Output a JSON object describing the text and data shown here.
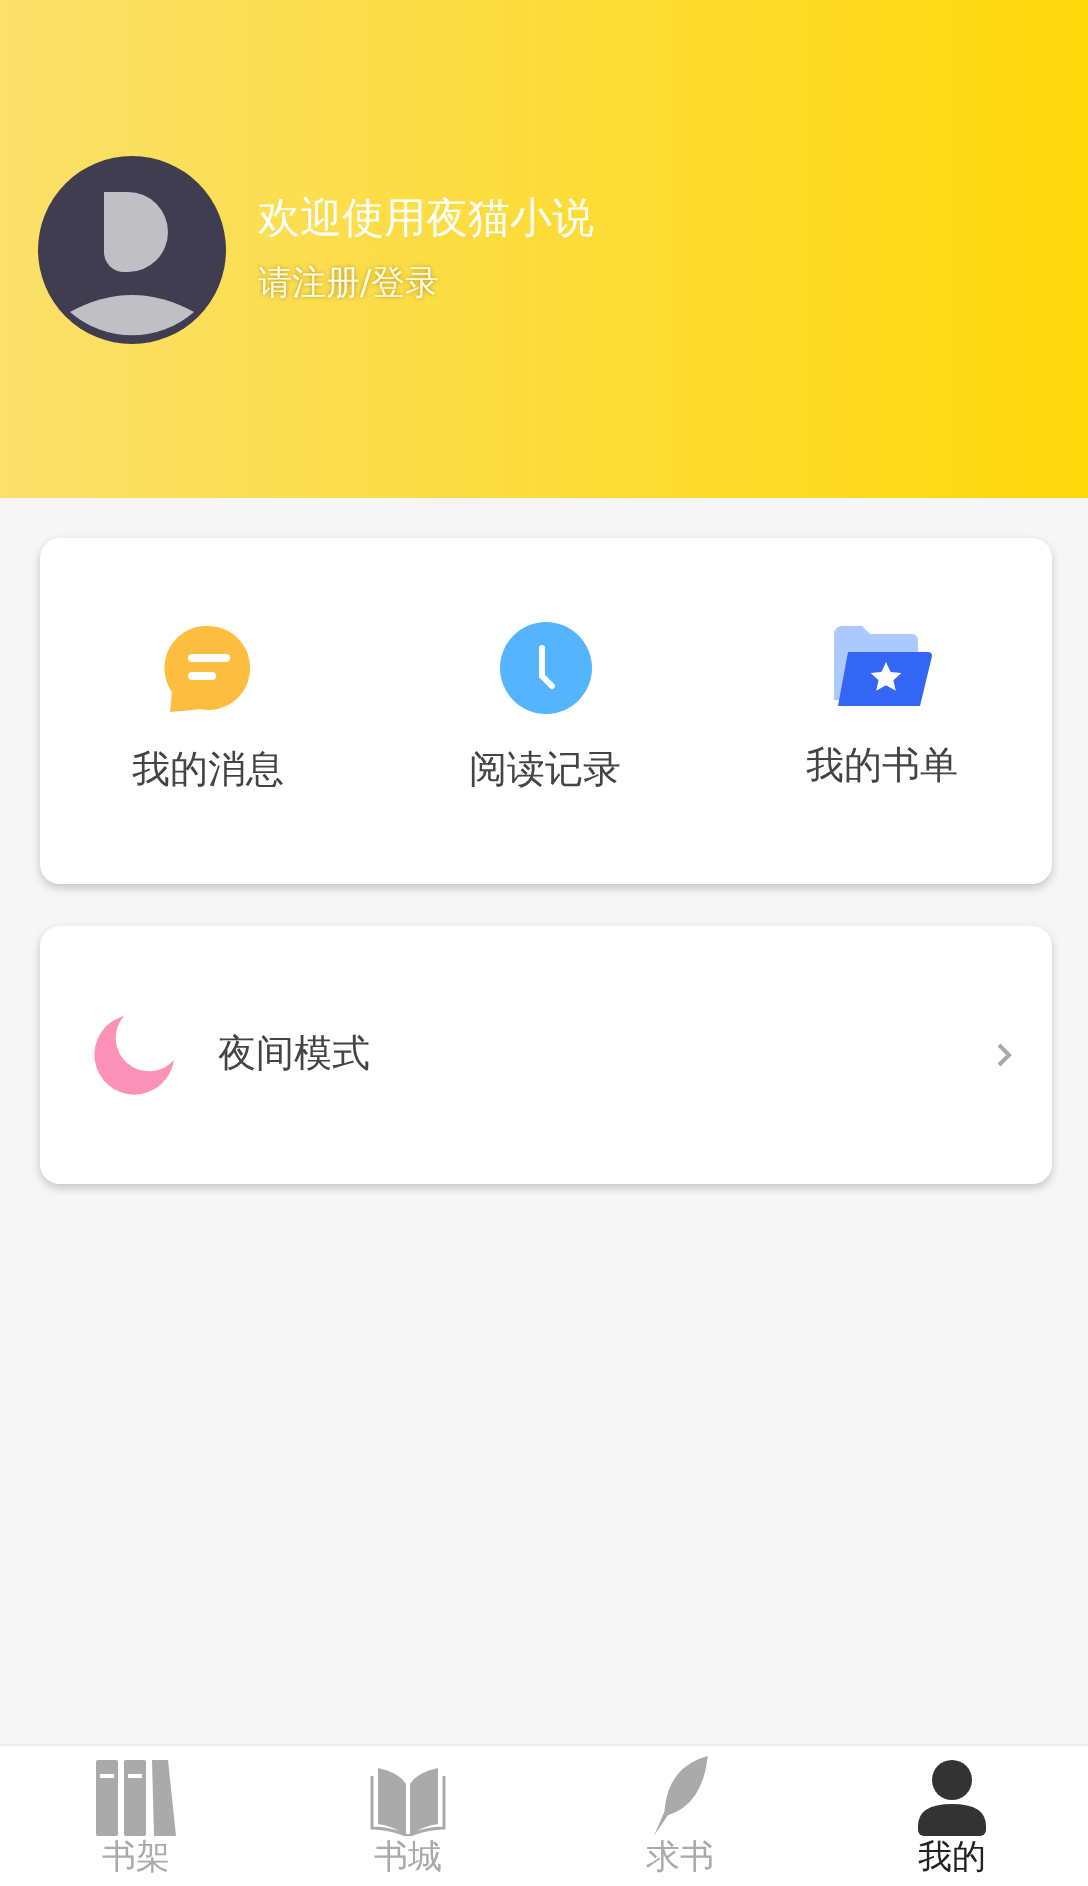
{
  "profile": {
    "title": "欢迎使用夜猫小说",
    "subtitle": "请注册/登录"
  },
  "shortcuts": [
    {
      "kind": "message",
      "label": "我的消息"
    },
    {
      "kind": "history",
      "label": "阅读记录"
    },
    {
      "kind": "booklist",
      "label": "我的书单"
    }
  ],
  "settings": [
    {
      "kind": "night",
      "label": "夜间模式"
    }
  ],
  "tabs": [
    {
      "kind": "shelf",
      "label": "书架",
      "selected": false
    },
    {
      "kind": "store",
      "label": "书城",
      "selected": false
    },
    {
      "kind": "request",
      "label": "求书",
      "selected": false
    },
    {
      "kind": "me",
      "label": "我的",
      "selected": true
    }
  ]
}
